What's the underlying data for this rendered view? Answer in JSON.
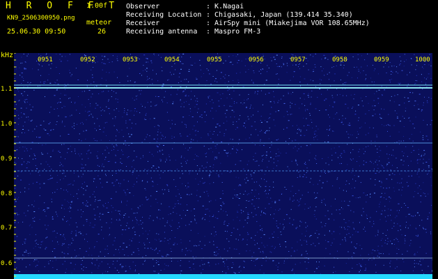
{
  "header": {
    "brand": "H R O F F T",
    "version": "1.00f",
    "filename": "KN9_2506300950.png",
    "meteor_label": "meteor",
    "datetime": "25.06.30 09:50",
    "meteor_count": "26",
    "meta": [
      {
        "key": "Observer",
        "value": ": K.Nagai"
      },
      {
        "key": "Receiving Location",
        "value": ": Chigasaki, Japan (139.414 35.340)"
      },
      {
        "key": "Receiver",
        "value": ": AirSpy mini (Miakejima VOR 108.65MHz)"
      },
      {
        "key": "Receiving antenna",
        "value": ": Maspro FM-3"
      }
    ]
  },
  "axis": {
    "y_unit": "kHz",
    "y_ticks": [
      "1.1",
      "1.0",
      "0.9",
      "0.8",
      "0.7",
      "0.6"
    ],
    "x_ticks": [
      "0951",
      "0952",
      "0953",
      "0954",
      "0955",
      "0956",
      "0957",
      "0958",
      "0959",
      "1000"
    ]
  },
  "colors": {
    "background": "#000000",
    "label_yellow": "#ffff00",
    "plot_bg": "#0a0f5a",
    "noise": "#2a3cc8",
    "signal_cyan": "#8fe8f0",
    "baseline_cyan": "#25d9ff"
  }
}
